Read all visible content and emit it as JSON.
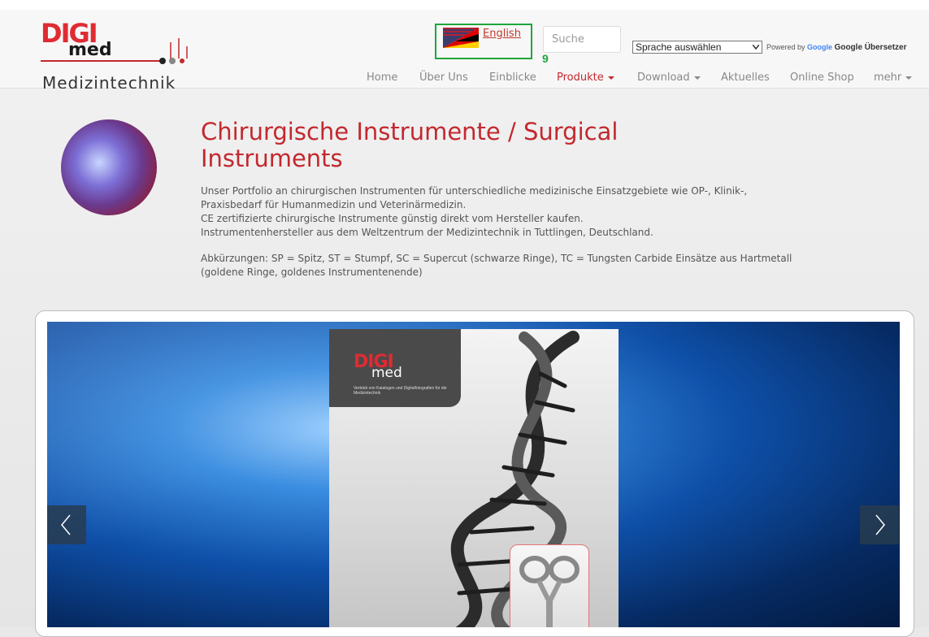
{
  "header": {
    "logo": {
      "brand": "DIGI",
      "brand_sub": "med",
      "tagline": "Medizintechnik"
    },
    "language_link": {
      "label": "English",
      "highlight_number": "9"
    },
    "search": {
      "placeholder": "Suche"
    },
    "translate": {
      "select_label": "Sprache auswählen",
      "powered_by": "Powered by",
      "google": "Google",
      "translator": "Google Übersetzer"
    },
    "nav": [
      {
        "label": "Home",
        "dropdown": false,
        "active": false
      },
      {
        "label": "Über Uns",
        "dropdown": false,
        "active": false
      },
      {
        "label": "Einblicke",
        "dropdown": false,
        "active": false
      },
      {
        "label": "Produkte",
        "dropdown": true,
        "active": true
      },
      {
        "label": "Download",
        "dropdown": true,
        "active": false
      },
      {
        "label": "Aktuelles",
        "dropdown": false,
        "active": false
      },
      {
        "label": "Online Shop",
        "dropdown": false,
        "active": false
      },
      {
        "label": "mehr",
        "dropdown": true,
        "active": false
      }
    ]
  },
  "main": {
    "title": "Chirurgische Instrumente / Surgical Instruments",
    "intro_lines": [
      "Unser Portfolio an chirurgischen Instrumenten für unterschiedliche medizinische Einsatzgebiete wie OP-, Klinik-,",
      "Praxisbedarf für Humanmedizin und Veterinärmedizin.",
      "CE zertifizierte chirurgische Instrumente günstig direkt vom Hersteller kaufen.",
      "Instrumentenhersteller aus dem Weltzentrum der Medizintechnik in Tuttlingen, Deutschland."
    ],
    "abbreviations": "Abkürzungen: SP = Spitz, ST = Stumpf, SC = Supercut (schwarze Ringe), TC = Tungsten Carbide Einsätze aus Hartmetall (goldene Ringe, goldenes Instrumentenende)"
  },
  "carousel": {
    "book_brand": "DIGI",
    "book_brand_sub": "med",
    "book_subtitle": "Vertrieb von Katalogen und Digitalfotografien für die Medizintechnik"
  },
  "colors": {
    "brand_red": "#c3282e",
    "highlight_green": "#1ea63a"
  },
  "icons": {
    "prev": "chevron-left-icon",
    "next": "chevron-right-icon",
    "flag": "us-de-flag-icon"
  }
}
